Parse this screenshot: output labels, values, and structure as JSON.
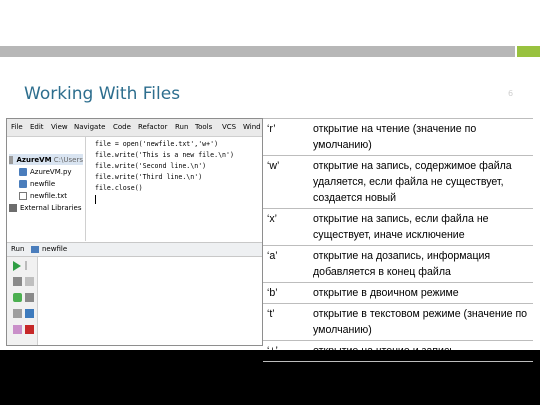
{
  "slide": {
    "title": "Working With Files",
    "slide_number": "6"
  },
  "ide": {
    "menu": [
      "File",
      "Edit",
      "View",
      "Navigate",
      "Code",
      "Refactor",
      "Run",
      "Tools",
      "VCS",
      "Wind"
    ],
    "project": {
      "root": "AzureVM",
      "root_path": "C:\\Users",
      "files": [
        "AzureVM.py",
        "newfile",
        "newfile.txt"
      ],
      "libraries": "External Libraries"
    },
    "code": [
      "file = open('newfile.txt','w+')",
      "file.write('This is a new file.\\n')",
      "file.write('Second line.\\n')",
      "file.write('Third line.\\n')",
      "file.close()"
    ],
    "run_label": "Run",
    "run_config": "newfile"
  },
  "modes": [
    {
      "mode": "‘r’",
      "desc": "открытие на чтение (значение по умолчанию)"
    },
    {
      "mode": "‘w’",
      "desc": "открытие на запись, содержимое файла удаляется, если файла не существует, создается новый"
    },
    {
      "mode": "‘x’",
      "desc": "открытие на запись, если файла не существует, иначе исключение"
    },
    {
      "mode": "‘a’",
      "desc": "открытие на дозапись, информация добавляется в конец файла"
    },
    {
      "mode": "‘b’",
      "desc": "открытие в двоичном режиме"
    },
    {
      "mode": "‘t’",
      "desc": "открытие в текстовом режиме (значение по умолчанию)"
    },
    {
      "mode": "‘+’",
      "desc": "открытие на чтение и запись"
    }
  ],
  "colors": {
    "title": "#2d6e8e",
    "accent": "#99c23f"
  }
}
